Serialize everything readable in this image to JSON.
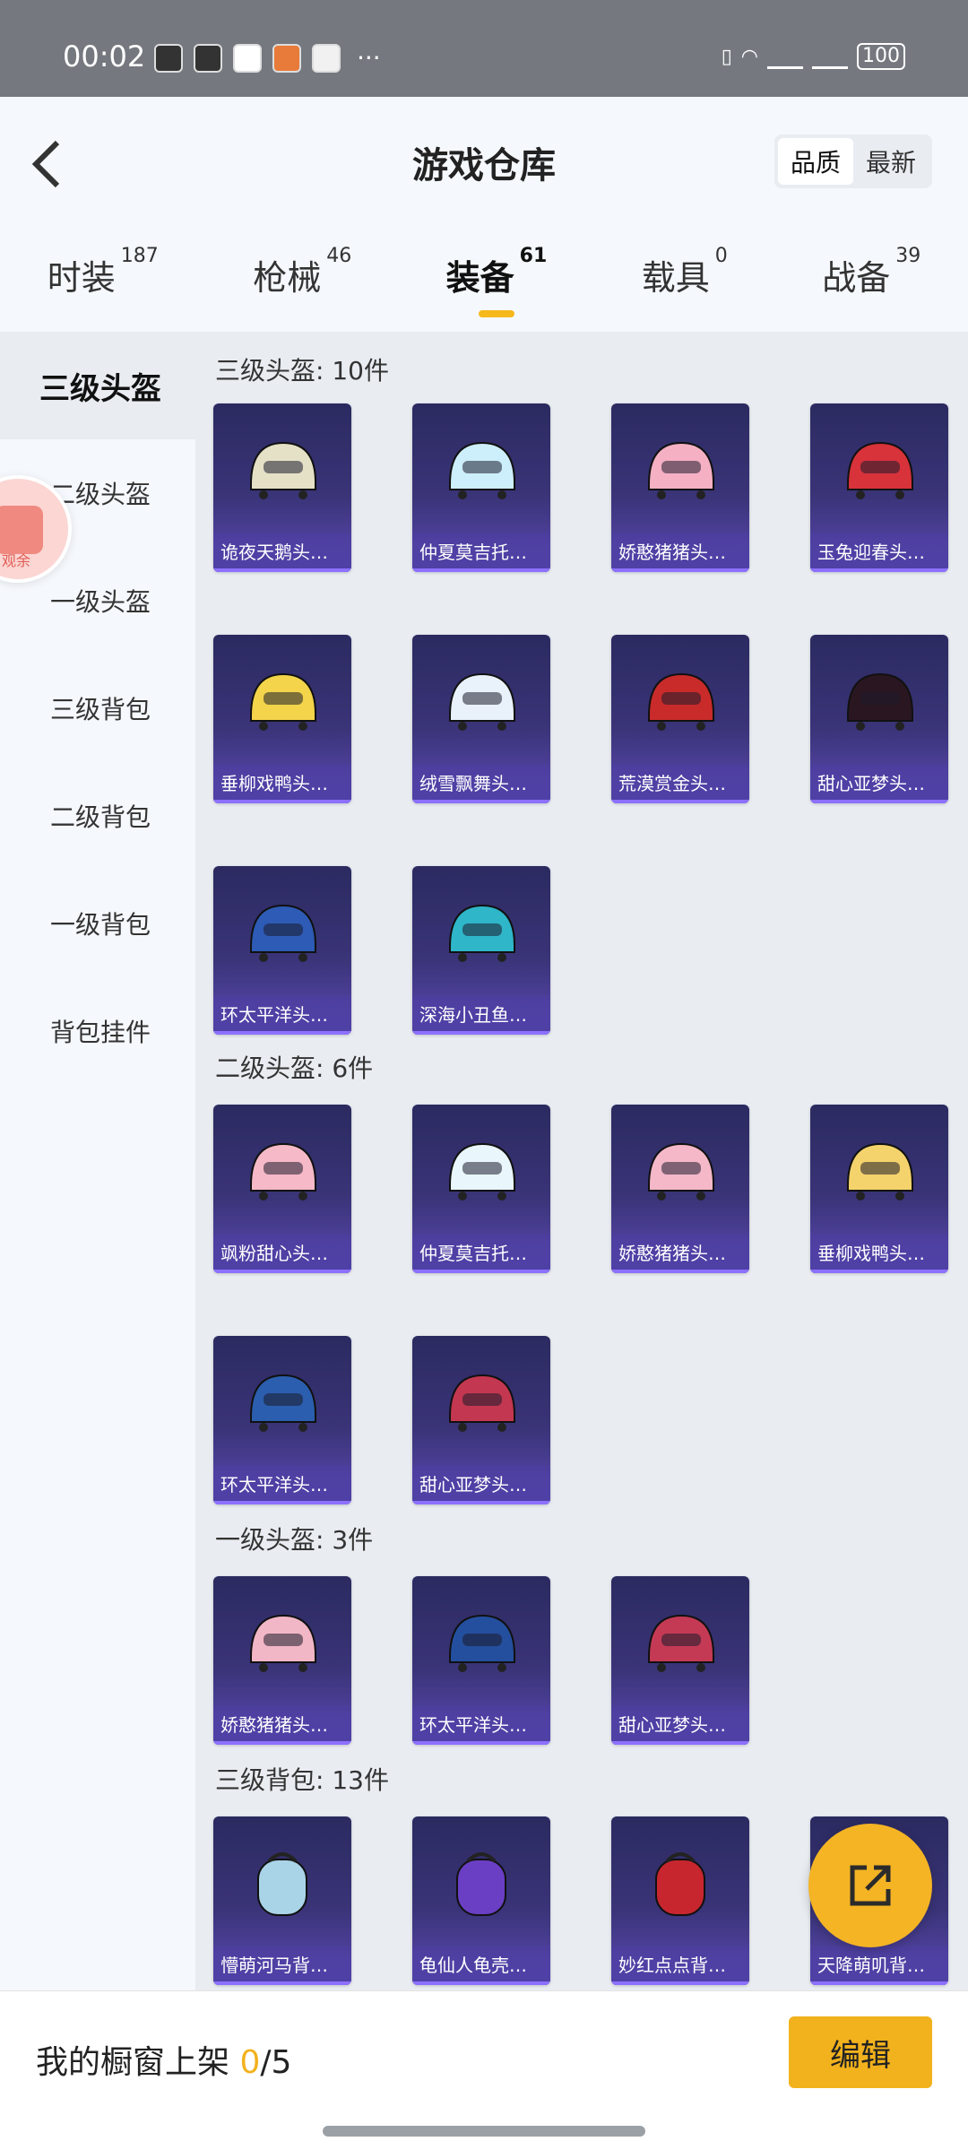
{
  "status_bar": {
    "time": "00:02",
    "more": "···",
    "battery": "100"
  },
  "header": {
    "title": "游戏仓库",
    "sort": [
      "品质",
      "最新"
    ],
    "sort_selected": "品质"
  },
  "tabs": [
    {
      "label": "时装",
      "count": "187"
    },
    {
      "label": "枪械",
      "count": "46"
    },
    {
      "label": "装备",
      "count": "61",
      "active": true
    },
    {
      "label": "载具",
      "count": "0"
    },
    {
      "label": "战备",
      "count": "39"
    }
  ],
  "sidebar": {
    "items": [
      "三级头盔",
      "二级头盔",
      "一级头盔",
      "三级背包",
      "二级背包",
      "一级背包",
      "背包挂件"
    ],
    "active": "三级头盔",
    "badge_text": "观余"
  },
  "sections": [
    {
      "title": "三级头盔: 10件",
      "items": [
        {
          "name": "诡夜天鹅头盔...",
          "color": "#e5e1c7"
        },
        {
          "name": "仲夏莫吉托头...",
          "color": "#cdeefb"
        },
        {
          "name": "娇憨猪猪头盔...",
          "color": "#f5b0c4"
        },
        {
          "name": "玉兔迎春头盔...",
          "color": "#d8323a"
        },
        {
          "name": "垂柳戏鸭头盔...",
          "color": "#f3d44a"
        },
        {
          "name": "绒雪飘舞头盔...",
          "color": "#e9f2fb"
        },
        {
          "name": "荒漠赏金头盔...",
          "color": "#c92b2b"
        },
        {
          "name": "甜心亚梦头盔...",
          "color": "#2a1620"
        },
        {
          "name": "环太平洋头盔...",
          "color": "#2d5bb5"
        },
        {
          "name": "深海小丑鱼头...",
          "color": "#2fb6c9"
        }
      ]
    },
    {
      "title": "二级头盔: 6件",
      "items": [
        {
          "name": "飒粉甜心头盔...",
          "color": "#f6b9c8"
        },
        {
          "name": "仲夏莫吉托头...",
          "color": "#e9f6fb"
        },
        {
          "name": "娇憨猪猪头盔...",
          "color": "#f5b8c9"
        },
        {
          "name": "垂柳戏鸭头盔...",
          "color": "#f5d36c"
        },
        {
          "name": "环太平洋头盔...",
          "color": "#2b5eae"
        },
        {
          "name": "甜心亚梦头盔...",
          "color": "#c43750"
        }
      ]
    },
    {
      "title": "一级头盔: 3件",
      "items": [
        {
          "name": "娇憨猪猪头盔...",
          "color": "#f2b7c6"
        },
        {
          "name": "环太平洋头盔...",
          "color": "#244f9e"
        },
        {
          "name": "甜心亚梦头盔...",
          "color": "#c43a55"
        }
      ]
    },
    {
      "title": "三级背包: 13件",
      "items": [
        {
          "name": "懵萌河马背包...",
          "color": "#a9d4e8"
        },
        {
          "name": "龟仙人龟壳背...",
          "color": "#6a3fc4"
        },
        {
          "name": "妙红点点背包...",
          "color": "#c7262f"
        },
        {
          "name": "天降萌叽背包...",
          "color": "#f0c24c"
        }
      ]
    }
  ],
  "bottom": {
    "showcase_label": "我的橱窗上架 ",
    "showcase_count": "0",
    "showcase_total": "/5",
    "edit_label": "编辑"
  },
  "colors": {
    "accent": "#f2b21d",
    "card": "#3a3478"
  }
}
